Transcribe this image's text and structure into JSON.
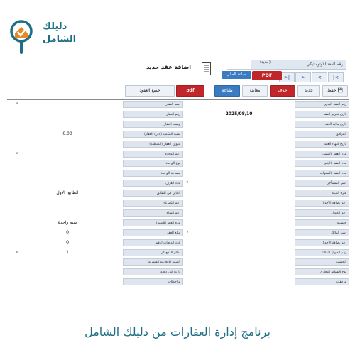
{
  "brand": {
    "line1": "دليلك",
    "line2": "الشامل",
    "color": "#1f6f84",
    "accent": "#e48a2b",
    "icon": "magnifier-with-house-icon"
  },
  "header": {
    "title": "اضافة عقد جديد",
    "auto_number_label": "رقم العقد الاوتوماتيكي",
    "new_tag": "(جديد)",
    "pdf_label": "PDF",
    "print_current_label": "طباعة الحالي",
    "nav": [
      "|<",
      "<",
      ">",
      ">|"
    ]
  },
  "toolbar": {
    "save": "حفظ",
    "new": "جديد",
    "delete": "حذف",
    "preview": "معاينة",
    "print": "طباعة",
    "pdf": "pdf",
    "all_contracts": "جميع العقود"
  },
  "form_right": [
    {
      "label": "رقم العقد اليدوي",
      "value": ""
    },
    {
      "label": "تاريخ تحرير العقد",
      "value": "2025/08/10"
    },
    {
      "label": "تاريخ بداية العقد",
      "value": ""
    },
    {
      "label": "الموافق",
      "value": ""
    },
    {
      "label": "تاريخ انتهاء العقد",
      "value": ""
    },
    {
      "label": "مدة العقد بالشهور",
      "value": ""
    },
    {
      "label": "مدة العقد بالايام",
      "value": ""
    },
    {
      "label": "مدة العقد بالسنوات",
      "value": ""
    },
    {
      "label": "اسم المستأجر",
      "value": ""
    },
    {
      "label": "فترة التنبيه",
      "value": ""
    },
    {
      "label": "رقم بطاقة الأحوال",
      "value": ""
    },
    {
      "label": "رقم الجوال",
      "value": ""
    },
    {
      "label": "جنسيته",
      "value": ""
    },
    {
      "label": "اسم المالك",
      "value": ""
    },
    {
      "label": "رقم بطاقة الأحوال",
      "value": ""
    },
    {
      "label": "رقم الجوال المالك",
      "value": ""
    },
    {
      "label": "الجنسية",
      "value": ""
    },
    {
      "label": "نوع النشاط التجاري",
      "value": ""
    },
    {
      "label": "مرفقات",
      "value": ""
    }
  ],
  "form_left": [
    {
      "label": "اسم العقار",
      "value": ""
    },
    {
      "label": "رقم العقار",
      "value": ""
    },
    {
      "label": "وصف العقار",
      "value": ""
    },
    {
      "label": "نسبة المكتب (ادارة العقار)",
      "value": "0.00"
    },
    {
      "label": "عنوان العقار (المنطقة)",
      "value": ""
    },
    {
      "label": "رقم الوحدة",
      "value": ""
    },
    {
      "label": "نوع الوحدة",
      "value": ""
    },
    {
      "label": "مساحة الوحدة",
      "value": ""
    },
    {
      "label": "عدد الغرف",
      "value": ""
    },
    {
      "label": "الكائن في الطابق",
      "value": "الطابق الاول"
    },
    {
      "label": "رقم الكهرباء",
      "value": ""
    },
    {
      "label": "رقم المياه",
      "value": ""
    },
    {
      "label": "مدة العقد (للتنبيه)",
      "value": "سنة واحدة"
    },
    {
      "label": "مبلغ العقد",
      "value": "0"
    },
    {
      "label": "عدد الدفعات (رقم)",
      "value": "0"
    },
    {
      "label": "نظام الدفع كل ..",
      "value": "1"
    },
    {
      "label": "القيمة الايجارية الشهرية",
      "value": ""
    },
    {
      "label": "تاريخ اول دفعة",
      "value": ""
    },
    {
      "label": "ملاحظات",
      "value": ""
    }
  ],
  "caption": "برنامج إدارة العقارات من دليلك الشامل"
}
